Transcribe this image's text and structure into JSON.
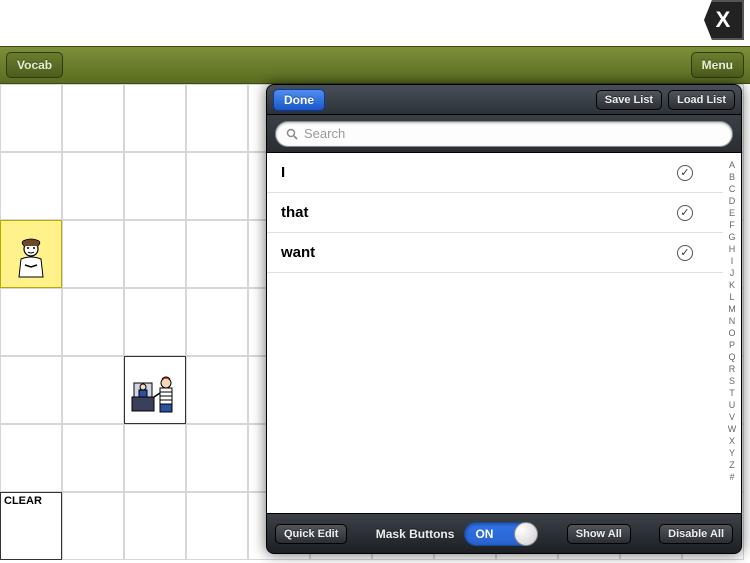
{
  "close_icon_label": "X",
  "header": {
    "left_button": "Vocab",
    "right_button": "Menu"
  },
  "grid": {
    "clear_label": "CLEAR"
  },
  "popover": {
    "done": "Done",
    "save_list": "Save List",
    "load_list": "Load List",
    "search_placeholder": "Search",
    "words": [
      {
        "text": "I",
        "checked": true
      },
      {
        "text": "that",
        "checked": true
      },
      {
        "text": "want",
        "checked": true
      }
    ],
    "index": [
      "A",
      "B",
      "C",
      "D",
      "E",
      "F",
      "G",
      "H",
      "I",
      "J",
      "K",
      "L",
      "M",
      "N",
      "O",
      "P",
      "Q",
      "R",
      "S",
      "T",
      "U",
      "V",
      "W",
      "X",
      "Y",
      "Z",
      "#"
    ],
    "bottom": {
      "quick_edit": "Quick Edit",
      "mask_buttons": "Mask Buttons",
      "toggle_state": "ON",
      "show_all": "Show All",
      "disable_all": "Disable All"
    }
  }
}
